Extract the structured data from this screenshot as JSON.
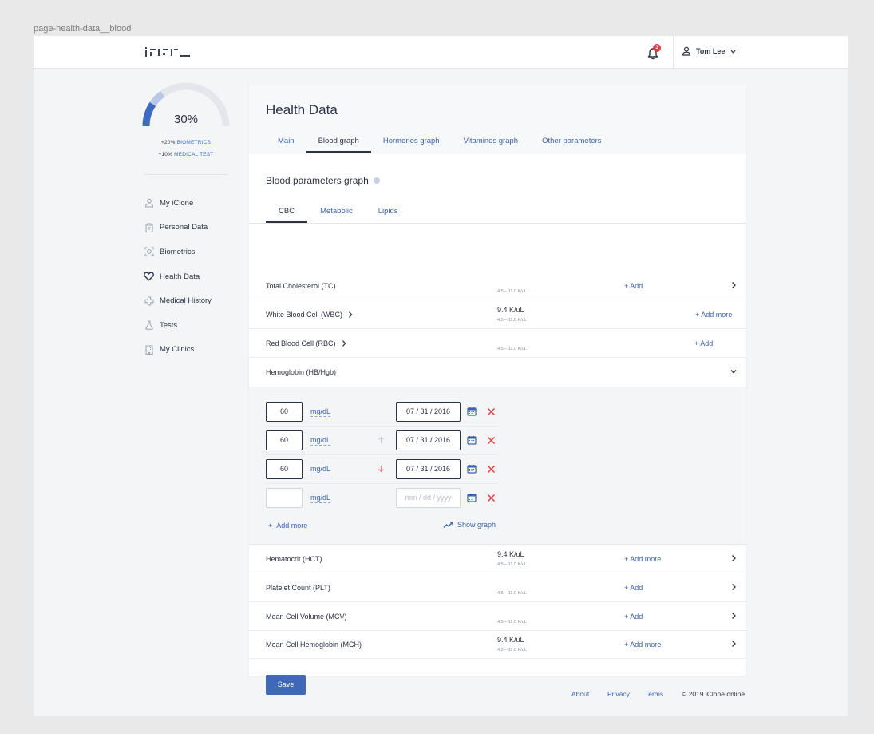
{
  "frame_label": "page-health-data__blood",
  "header": {
    "notifications_count": "3",
    "user_name": "Tom Lee"
  },
  "sidebar": {
    "progress": {
      "value": 0.3,
      "label": "30%"
    },
    "bonuses": [
      {
        "amount": "+20%",
        "label": "BIOMETRICS"
      },
      {
        "amount": "+10%",
        "label": "MEDICAL TEST"
      }
    ],
    "items": [
      {
        "label": "My iClone",
        "icon": "user-doctor-icon"
      },
      {
        "label": "Personal Data",
        "icon": "clipboard-icon"
      },
      {
        "label": "Biometrics",
        "icon": "scan-icon"
      },
      {
        "label": "Health Data",
        "icon": "heart-icon",
        "active": true
      },
      {
        "label": "Medical History",
        "icon": "medical-cross-icon"
      },
      {
        "label": "Tests",
        "icon": "flask-icon"
      },
      {
        "label": "My Clinics",
        "icon": "building-icon"
      }
    ]
  },
  "main": {
    "title": "Health Data",
    "tabs": [
      "Main",
      "Blood graph",
      "Hormones graph",
      "Vitamines graph",
      "Other parameters"
    ],
    "active_tab": "Blood graph",
    "section_title": "Blood parameters graph",
    "subtabs": [
      "CBC",
      "Metabolic",
      "Lipids"
    ],
    "active_subtab": "CBC",
    "rows": [
      {
        "name": "Total Cholesterol (TC)",
        "value": "",
        "range": "4.5 – 11.0 K/uL",
        "action": "Add",
        "has_chevron_right": true
      },
      {
        "name": "White Blood Cell (WBC)",
        "value": "9.4 K/uL",
        "range": "4.5 – 11.0 K/uL",
        "action": "Add more",
        "inline_chevron": true
      },
      {
        "name": "Red Blood Cell (RBC)",
        "value": "",
        "range": "4.5 – 11.0 K/uL",
        "action": "Add",
        "inline_chevron": true
      },
      {
        "name": "Hemoglobin (HB/Hgb)",
        "expanded": true
      }
    ],
    "hemoglobin_entries": [
      {
        "value": "60",
        "unit": "mg/dL",
        "trend": "",
        "date": "07 / 31 / 2016"
      },
      {
        "value": "60",
        "unit": "mg/dL",
        "trend": "up",
        "date": "07 / 31 / 2016"
      },
      {
        "value": "60",
        "unit": "mg/dL",
        "trend": "down",
        "date": "07 / 31 / 2016"
      },
      {
        "value": "",
        "unit": "mg/dL",
        "trend": "",
        "date": "",
        "date_placeholder": "mm / dd / yyyy"
      }
    ],
    "expand_add_more": "Add more",
    "expand_show_graph": "Show graph",
    "rows_after": [
      {
        "name": "Hematocrit (HCT)",
        "value": "9.4 K/uL",
        "range": "4.5 – 11.0 K/uL",
        "action": "Add more"
      },
      {
        "name": "Platelet Count (PLT)",
        "value": "",
        "range": "4.5 – 11.0 K/uL",
        "action": "Add"
      },
      {
        "name": "Mean Cell Volume (MCV)",
        "value": "",
        "range": "4.5 – 11.0 K/uL",
        "action": "Add"
      },
      {
        "name": "Mean Cell Hemoglobin (MCH)",
        "value": "9.4 K/uL",
        "range": "4.5 – 11.0 K/uL",
        "action": "Add more"
      }
    ],
    "save_label": "Save"
  },
  "footer": {
    "links": [
      "About",
      "Privacy",
      "Terms"
    ],
    "copyright": "© 2019 iClone.online"
  },
  "colors": {
    "accent": "#3a63ad",
    "button": "#4068b9",
    "danger": "#e53945",
    "text": "#2b3244"
  }
}
